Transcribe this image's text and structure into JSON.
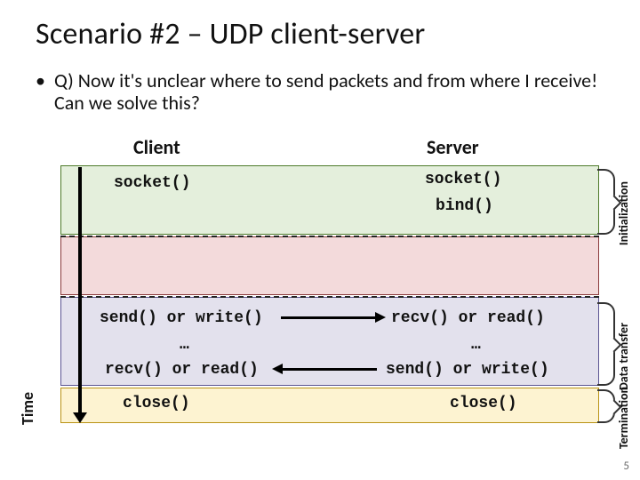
{
  "title": "Scenario #2 – UDP client-server",
  "bullet": "Q) Now it's unclear where to send packets and from where I receive! Can we solve this?",
  "columns": {
    "client": "Client",
    "server": "Server"
  },
  "phase_labels": {
    "init": "Initialization",
    "data": "Data transfer",
    "term": "Termination"
  },
  "axis_label": "Time",
  "client": {
    "socket": "socket()",
    "send": "send() or write()",
    "middle": "…",
    "recv": "recv() or read()",
    "close": "close()"
  },
  "server": {
    "socket": "socket()",
    "bind": "bind()",
    "recv": "recv() or read()",
    "middle": "…",
    "send": "send() or write()",
    "close": "close()"
  },
  "page_number": "5"
}
